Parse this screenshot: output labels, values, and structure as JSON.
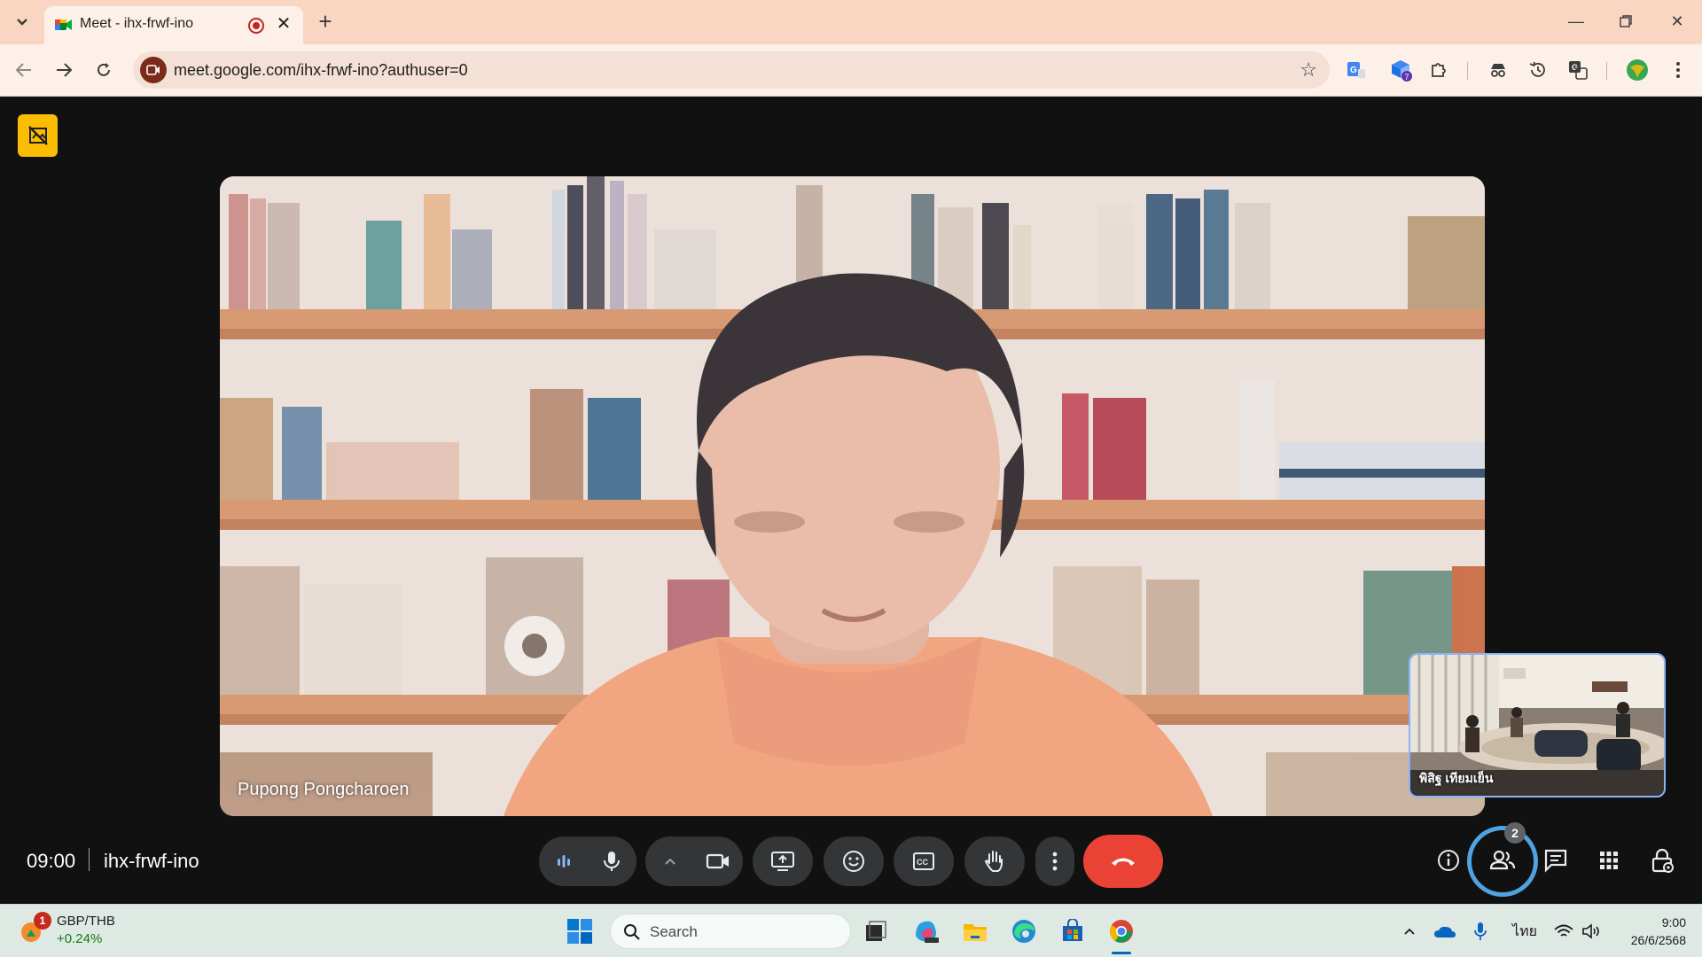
{
  "browser": {
    "tab_title": "Meet - ihx-frwf-ino",
    "url": "meet.google.com/ihx-frwf-ino?authuser=0",
    "extension_badge": "7"
  },
  "meet": {
    "speaker_name": "Pupong Pongcharoen",
    "self_name": "พิสิฐ เทียมเย็น",
    "time": "09:00",
    "meeting_code": "ihx-frwf-ino",
    "participant_count": "2",
    "accent_color": "#4fa3e0",
    "hangup_color": "#ea4335"
  },
  "taskbar": {
    "widget_title": "GBP/THB",
    "widget_change": "+0.24%",
    "widget_badge": "1",
    "search_label": "Search",
    "language": "ไทย",
    "clock_time": "9:00",
    "clock_date": "26/6/2568"
  }
}
